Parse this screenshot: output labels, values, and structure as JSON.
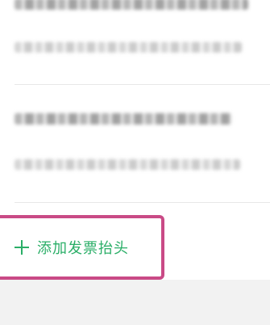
{
  "add_header_button": {
    "label": "添加发票抬头",
    "color": "#2aae67",
    "icon": "plus-icon"
  },
  "highlight_color": "#c94a86"
}
